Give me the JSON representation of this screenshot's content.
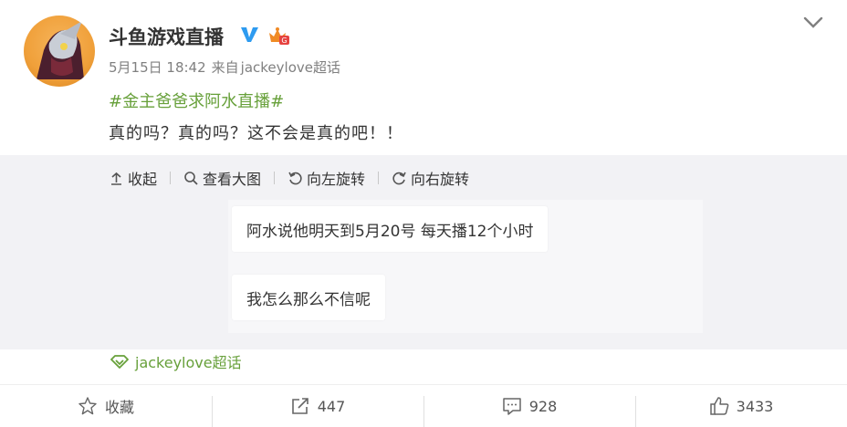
{
  "post": {
    "author": "斗鱼游戏直播",
    "date": "5月15日 18:42",
    "source_prefix": "来自",
    "source": "jackeylove超话",
    "topic": "#金主爸爸求阿水直播#",
    "text": "真的吗？真的吗？这不会是真的吧！！"
  },
  "media_toolbar": {
    "collapse": "收起",
    "view_large": "查看大图",
    "rotate_left": "向左旋转",
    "rotate_right": "向右旋转"
  },
  "image": {
    "line1": "阿水说他明天到5月20号  每天播12个小时",
    "line2": "我怎么那么不信呢"
  },
  "supertopic": {
    "label": "jackeylove超话"
  },
  "actions": {
    "favorite": "收藏",
    "repost": "447",
    "comment": "928",
    "like": "3433"
  },
  "colors": {
    "topic_green": "#67a03a",
    "verified_blue": "#2e9bf0",
    "crown_orange": "#f08a24"
  },
  "icons": [
    "chevron-down-icon",
    "verified-icon",
    "crown-badge-icon",
    "upload-icon",
    "magnifier-icon",
    "rotate-left-icon",
    "rotate-right-icon",
    "supertopic-diamond-icon",
    "star-icon",
    "share-icon",
    "comment-icon",
    "thumbs-up-icon"
  ]
}
